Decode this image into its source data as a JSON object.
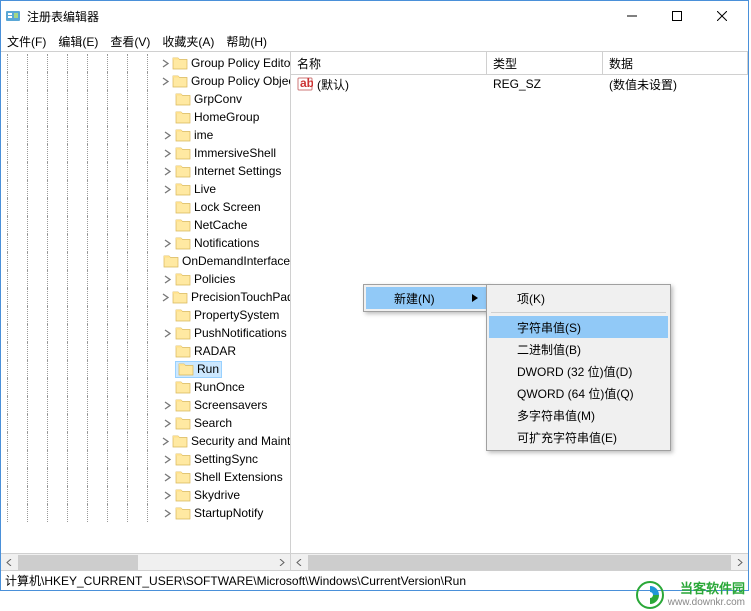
{
  "window": {
    "title": "注册表编辑器"
  },
  "menubar": [
    "文件(F)",
    "编辑(E)",
    "查看(V)",
    "收藏夹(A)",
    "帮助(H)"
  ],
  "tree": {
    "items": [
      {
        "label": "Group Policy Editor",
        "exp": "closed"
      },
      {
        "label": "Group Policy Object",
        "exp": "closed"
      },
      {
        "label": "GrpConv",
        "exp": "none"
      },
      {
        "label": "HomeGroup",
        "exp": "none"
      },
      {
        "label": "ime",
        "exp": "closed"
      },
      {
        "label": "ImmersiveShell",
        "exp": "closed"
      },
      {
        "label": "Internet Settings",
        "exp": "closed"
      },
      {
        "label": "Live",
        "exp": "closed"
      },
      {
        "label": "Lock Screen",
        "exp": "none"
      },
      {
        "label": "NetCache",
        "exp": "none"
      },
      {
        "label": "Notifications",
        "exp": "closed"
      },
      {
        "label": "OnDemandInterface",
        "exp": "none"
      },
      {
        "label": "Policies",
        "exp": "closed"
      },
      {
        "label": "PrecisionTouchPad",
        "exp": "closed"
      },
      {
        "label": "PropertySystem",
        "exp": "none"
      },
      {
        "label": "PushNotifications",
        "exp": "closed"
      },
      {
        "label": "RADAR",
        "exp": "none"
      },
      {
        "label": "Run",
        "exp": "none",
        "selected": true
      },
      {
        "label": "RunOnce",
        "exp": "none"
      },
      {
        "label": "Screensavers",
        "exp": "closed"
      },
      {
        "label": "Search",
        "exp": "closed"
      },
      {
        "label": "Security and Mainte",
        "exp": "closed"
      },
      {
        "label": "SettingSync",
        "exp": "closed"
      },
      {
        "label": "Shell Extensions",
        "exp": "closed"
      },
      {
        "label": "Skydrive",
        "exp": "closed"
      },
      {
        "label": "StartupNotify",
        "exp": "closed"
      }
    ]
  },
  "list": {
    "columns": {
      "name": "名称",
      "type": "类型",
      "data": "数据"
    },
    "rows": [
      {
        "name": "(默认)",
        "type": "REG_SZ",
        "data": "(数值未设置)"
      }
    ]
  },
  "context": {
    "new_label": "新建(N)",
    "submenu": [
      {
        "label": "项(K)",
        "sep_after": true
      },
      {
        "label": "字符串值(S)",
        "highlight": true
      },
      {
        "label": "二进制值(B)"
      },
      {
        "label": "DWORD (32 位)值(D)"
      },
      {
        "label": "QWORD (64 位)值(Q)"
      },
      {
        "label": "多字符串值(M)"
      },
      {
        "label": "可扩充字符串值(E)"
      }
    ]
  },
  "statusbar": "计算机\\HKEY_CURRENT_USER\\SOFTWARE\\Microsoft\\Windows\\CurrentVersion\\Run",
  "watermark": {
    "cn": "当客软件园",
    "url": "www.downkr.com"
  }
}
